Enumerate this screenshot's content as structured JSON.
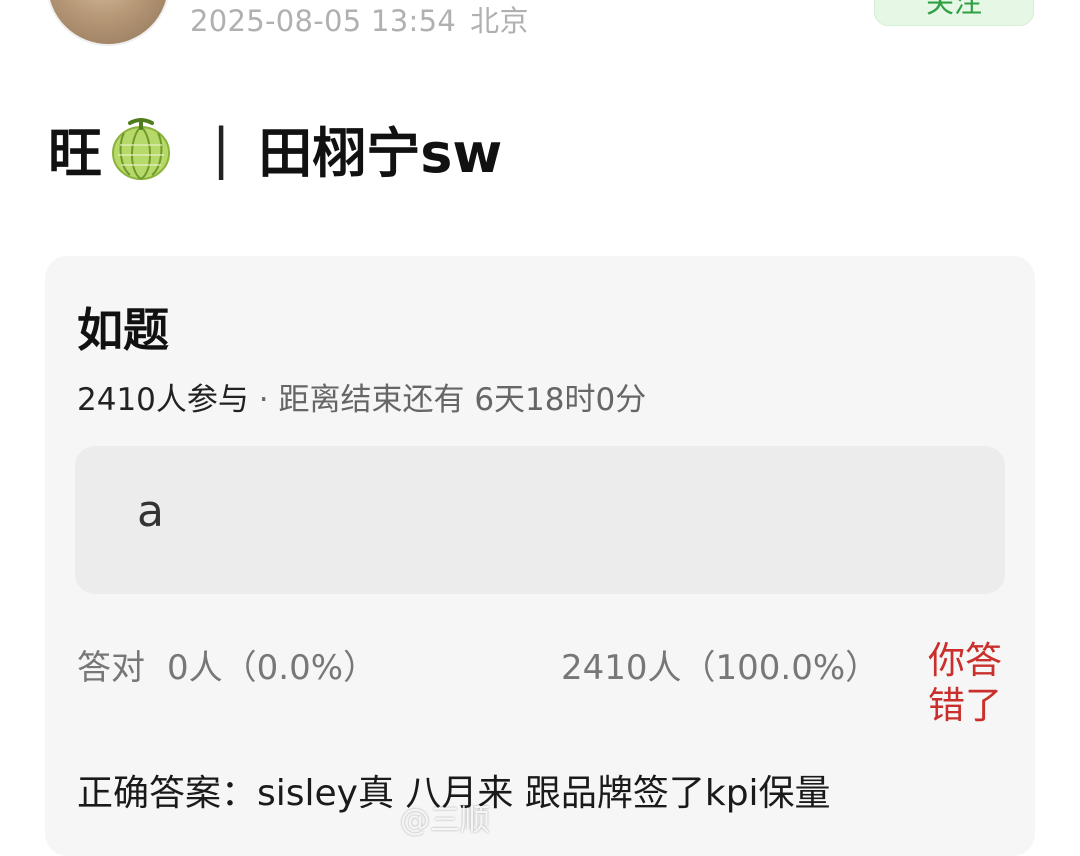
{
  "post": {
    "timestamp": "2025-08-05 13:54",
    "location": "北京",
    "follow_label": "关注",
    "title_prefix": "旺",
    "title_emoji": "melon-icon",
    "title_separator": "|",
    "title_name": "田栩宁sw"
  },
  "quiz": {
    "title": "如题",
    "participants": "2410人参与",
    "meta_rest": " · 距离结束还有 6天18时0分",
    "option_text": "a",
    "correct_label": "答对",
    "correct_stats": "0人（0.0%）",
    "wrong_stats": "2410人（100.0%）",
    "result_label": "你答错了",
    "answer": "正确答案：sisley真 八月来 跟品牌签了kpi保量"
  },
  "watermark": "@三顺"
}
